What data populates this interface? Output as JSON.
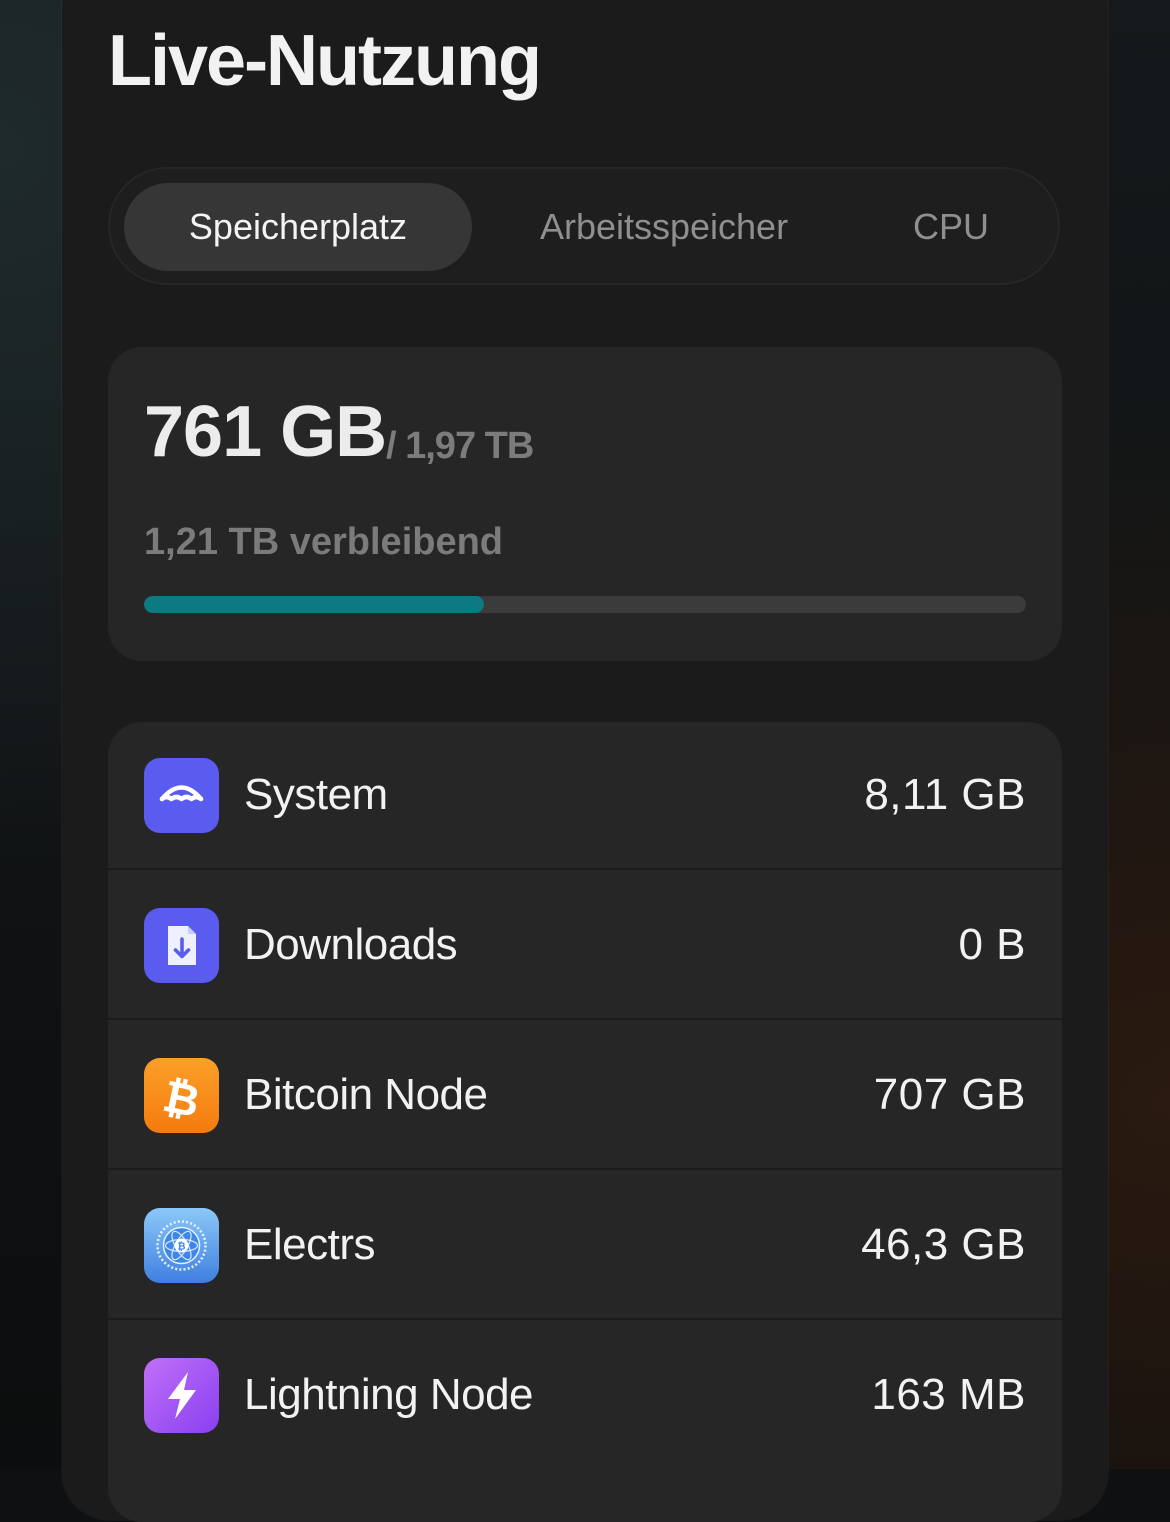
{
  "page": {
    "title": "Live-Nutzung"
  },
  "tabs": [
    {
      "label": "Speicherplatz",
      "active": true
    },
    {
      "label": "Arbeitsspeicher",
      "active": false
    },
    {
      "label": "CPU",
      "active": false
    }
  ],
  "storage": {
    "used": "761 GB",
    "total": "/ 1,97 TB",
    "remaining": "1,21 TB verbleibend",
    "progress_fraction": 0.386,
    "progress_color": "#0c7a80"
  },
  "apps": [
    {
      "name": "System",
      "size": "8,11 GB",
      "icon": "umbrella-icon",
      "icon_color": "#5a5cf0"
    },
    {
      "name": "Downloads",
      "size": "0 B",
      "icon": "download-file-icon",
      "icon_color": "#5a5cf0"
    },
    {
      "name": "Bitcoin Node",
      "size": "707 GB",
      "icon": "bitcoin-icon",
      "icon_color": "#f7931a"
    },
    {
      "name": "Electrs",
      "size": "46,3 GB",
      "icon": "electrs-icon",
      "icon_color": "#4a8ee8"
    },
    {
      "name": "Lightning Node",
      "size": "163 MB",
      "icon": "lightning-icon",
      "icon_color": "#a555f0"
    }
  ]
}
